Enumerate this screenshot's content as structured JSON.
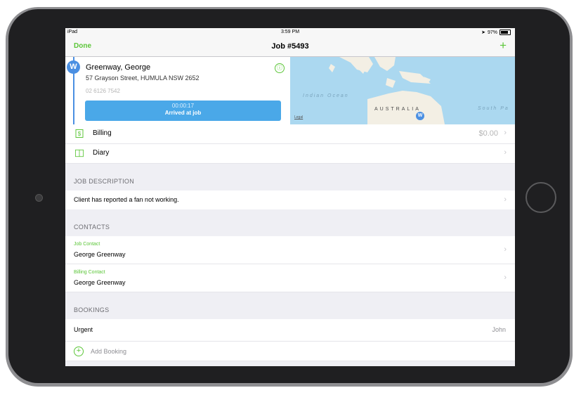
{
  "status_bar": {
    "device": "iPad",
    "time": "3:59 PM",
    "battery": "97%"
  },
  "nav": {
    "done_label": "Done",
    "title": "Job #5493",
    "add_label": "+"
  },
  "client": {
    "badge": "W",
    "name": "Greenway, George",
    "address": "57 Grayson Street, HUMULA NSW 2652",
    "phone": "02 6126 7542",
    "timer": "00:00:17",
    "status_button": "Arrived at job",
    "info_icon": "ⓘ"
  },
  "map": {
    "ocean_label": "Indian Ocean",
    "country_label": "AUSTRALIA",
    "region_label": "South Pa",
    "legal_label": "Legal",
    "pin_label": "W"
  },
  "rows": {
    "billing": {
      "label": "Billing",
      "value": "$0.00"
    },
    "diary": {
      "label": "Diary"
    }
  },
  "sections": {
    "job_description": {
      "header": "JOB DESCRIPTION",
      "text": "Client has reported a fan not working."
    },
    "contacts": {
      "header": "CONTACTS",
      "items": [
        {
          "role": "Job Contact",
          "name": "George Greenway"
        },
        {
          "role": "Billing Contact",
          "name": "George Greenway"
        }
      ]
    },
    "bookings": {
      "header": "BOOKINGS",
      "items": [
        {
          "label": "Urgent",
          "assignee": "John"
        }
      ],
      "add_label": "Add Booking"
    }
  },
  "icons": {
    "billing": "dollar-document-icon",
    "diary": "book-icon",
    "chevron": "›",
    "add": "+"
  },
  "colors": {
    "accent_green": "#5cc639",
    "accent_blue": "#4a8fe2",
    "button_blue": "#4aa8e8"
  }
}
